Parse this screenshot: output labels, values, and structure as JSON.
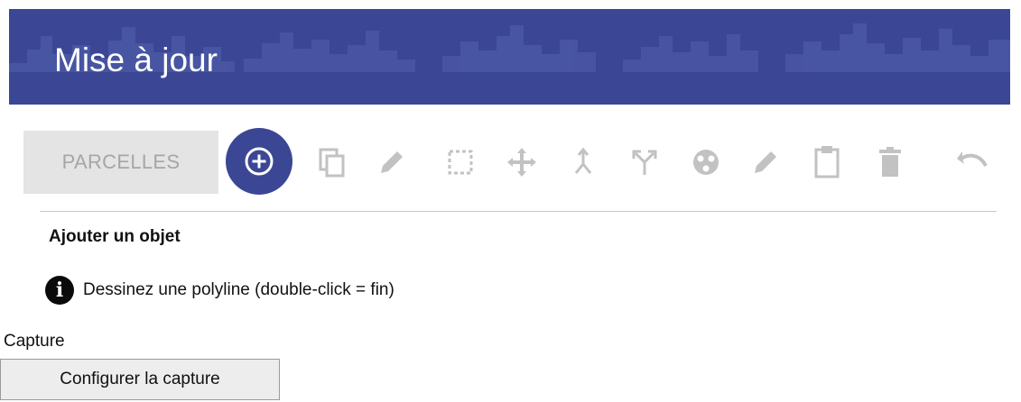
{
  "header": {
    "title": "Mise à jour"
  },
  "toolbar": {
    "layer_tab_label": "PARCELLES",
    "tools": [
      {
        "icon": "add-circle-icon",
        "state": "active"
      },
      {
        "icon": "copy-icon",
        "state": "disabled"
      },
      {
        "icon": "pencil-icon",
        "state": "disabled"
      },
      {
        "icon": "select-box-icon",
        "state": "disabled"
      },
      {
        "icon": "move-icon",
        "state": "disabled"
      },
      {
        "icon": "merge-icon",
        "state": "disabled"
      },
      {
        "icon": "split-icon",
        "state": "disabled"
      },
      {
        "icon": "aggregate-icon",
        "state": "disabled"
      },
      {
        "icon": "edit-attributes-icon",
        "state": "disabled"
      },
      {
        "icon": "clipboard-icon",
        "state": "disabled"
      },
      {
        "icon": "trash-icon",
        "state": "disabled"
      },
      {
        "icon": "undo-icon",
        "state": "disabled"
      }
    ]
  },
  "panel": {
    "section_title": "Ajouter un objet",
    "info_icon": "info-icon",
    "info_text": "Dessinez une polyline (double-click = fin)"
  },
  "capture": {
    "label": "Capture",
    "button_label": "Configurer la capture"
  },
  "colors": {
    "header_bg": "#3b4795",
    "active_tool_bg": "#3b4795",
    "disabled_icon": "#c2c2c2",
    "tab_bg": "#e4e4e4",
    "tab_text": "#a6a6a6"
  }
}
